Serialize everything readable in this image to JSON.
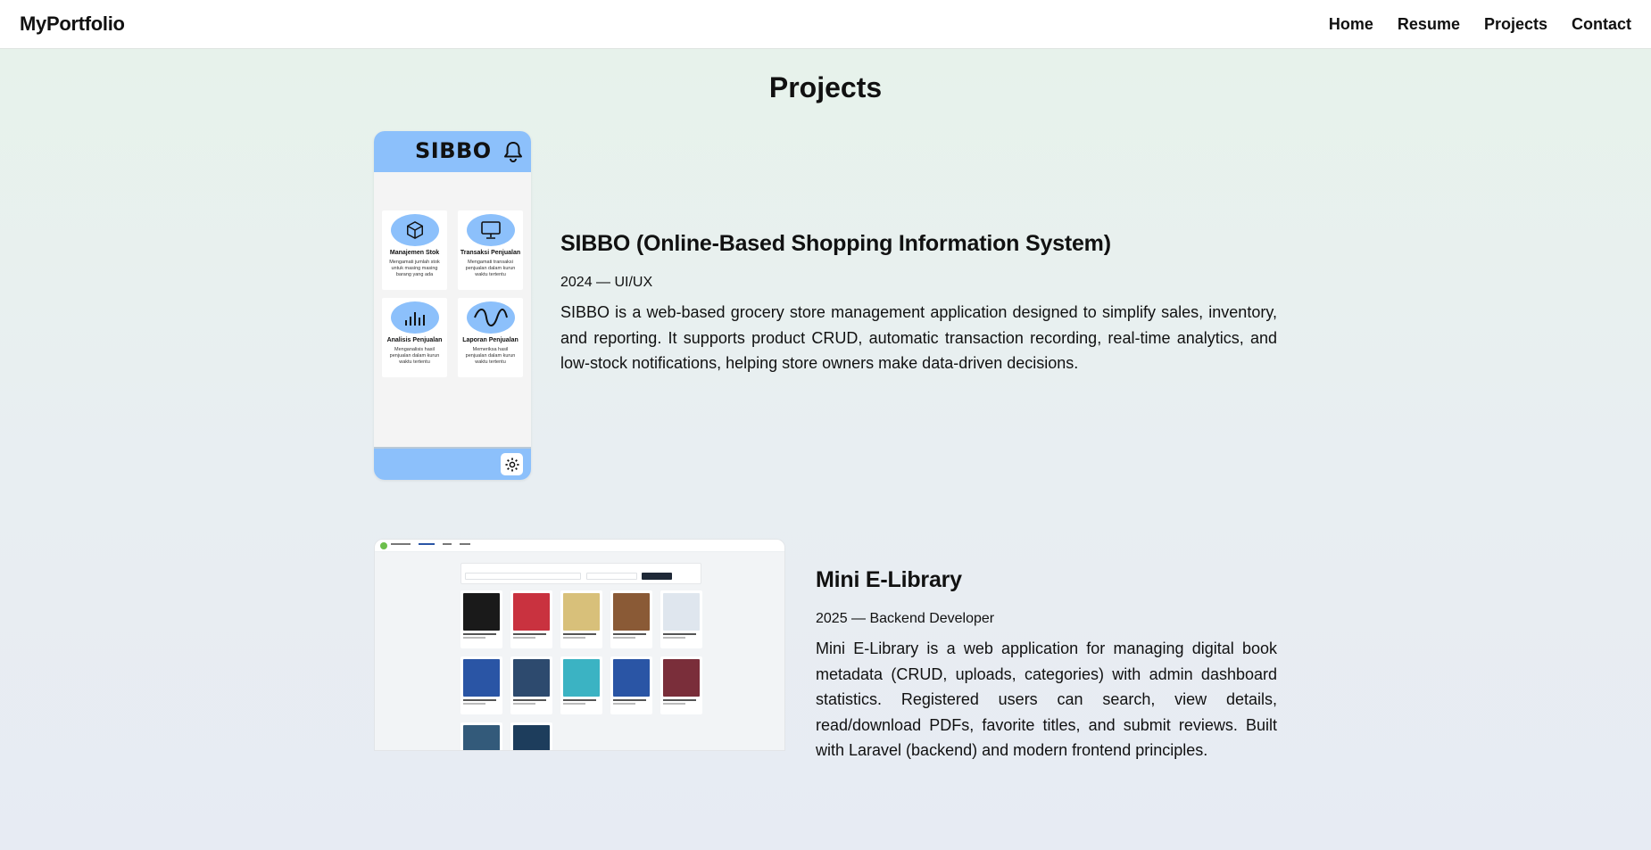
{
  "navbar": {
    "brand": "MyPortfolio",
    "links": [
      "Home",
      "Resume",
      "Projects",
      "Contact"
    ]
  },
  "page": {
    "title": "Projects"
  },
  "projects": [
    {
      "title": "SIBBO (Online-Based Shopping Information System)",
      "meta": "2024 — UI/UX",
      "description": "SIBBO is a web-based grocery store management application designed to simplify sales, inventory, and reporting. It supports product CRUD, automatic transaction recording, real-time analytics, and low-stock notifications, helping store owners make data-driven decisions.",
      "mockup": {
        "logo": "SIBBO",
        "cards": [
          {
            "icon": "box-icon",
            "title": "Manajemen Stok",
            "desc": "Mengamati jumlah stok untuk masing masing barang yang ada"
          },
          {
            "icon": "monitor-icon",
            "title": "Transaksi Penjualan",
            "desc": "Mengamati transaksi penjualan dalam kurun waktu tertentu"
          },
          {
            "icon": "bar-chart-icon",
            "title": "Analisis Penjualan",
            "desc": "Menganalisis hasil penjualan dalam kurun waktu tertentu"
          },
          {
            "icon": "wave-icon",
            "title": "Laporan Penjualan",
            "desc": "Memeriksa hasil penjualan dalam kurun waktu tertentu"
          }
        ]
      }
    },
    {
      "title": "Mini E-Library",
      "meta": "2025 — Backend Developer",
      "description": "Mini E-Library is a web application for managing digital book metadata (CRUD, uploads, categories) with admin dashboard statistics. Registered users can search, view details, read/download PDFs, favorite titles, and submit reviews. Built with Laravel (backend) and modern frontend principles.",
      "mockup": {
        "cover_colors": [
          "#1a1a1a",
          "#c9323f",
          "#d8c07a",
          "#8a5a36",
          "#dfe6ee",
          "#2a55a5",
          "#2d4a6e",
          "#3bb3c3",
          "#2a55a5",
          "#7a2e3a",
          "#335a7a",
          "#1d3d5c"
        ]
      }
    }
  ]
}
